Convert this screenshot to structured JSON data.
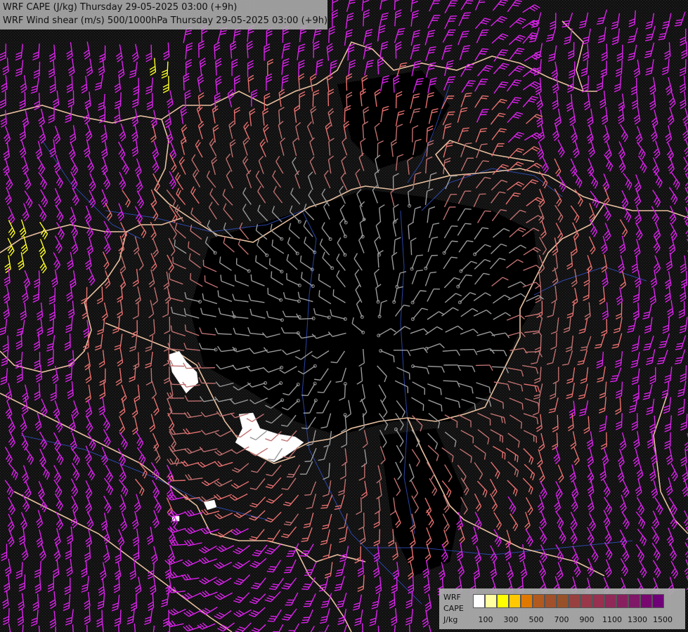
{
  "titles": {
    "line1": "WRF CAPE (J/kg) Thursday 29-05-2025 03:00 (+9h)",
    "line2": "WRF Wind shear (m/s) 500/1000hPa Thursday 29-05-2025 03:00 (+9h)"
  },
  "legend": {
    "head1": "WRF",
    "head2": "CAPE",
    "head3": "J/kg",
    "colors": [
      "#ffffff",
      "#ffffa0",
      "#ffff00",
      "#ffc800",
      "#e07800",
      "#b05a20",
      "#a0502a",
      "#985028",
      "#984040",
      "#983848",
      "#983050",
      "#902858",
      "#882060",
      "#801868",
      "#780870",
      "#700078"
    ],
    "ticks": [
      "100",
      "300",
      "500",
      "700",
      "900",
      "1100",
      "1300",
      "1500"
    ]
  },
  "field": {
    "barb_colors": {
      "low": "#9a9a9a",
      "mid": "#c07070",
      "high": "#e87070",
      "strong": "#dd22ee",
      "extreme": "#ffff22"
    },
    "border_color": "#e8c0a0",
    "river_color": "#3355cc",
    "cape_patch_color": "#ffffff"
  }
}
